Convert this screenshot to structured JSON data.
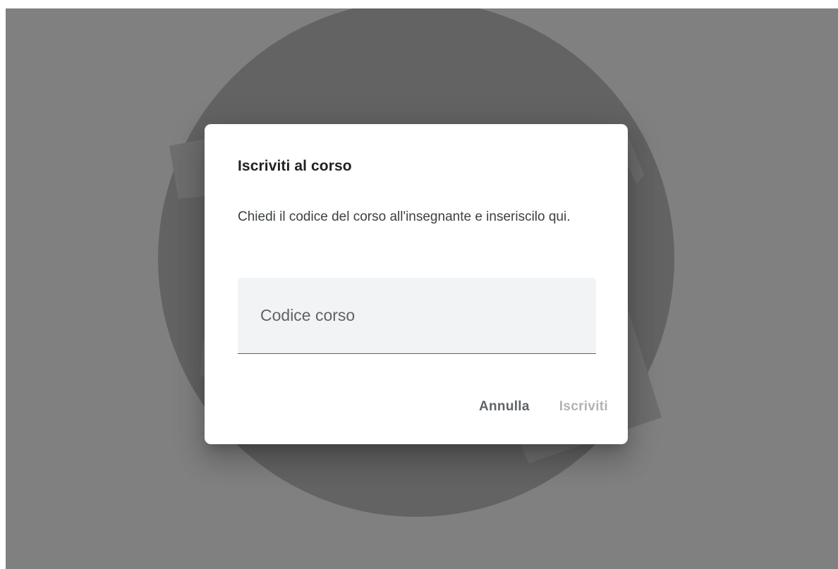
{
  "dialog": {
    "title": "Iscriviti al corso",
    "description": "Chiedi il codice del corso all'insegnante e inseriscilo qui.",
    "code_input": {
      "placeholder": "Codice corso",
      "value": ""
    },
    "cancel_label": "Annulla",
    "join_label": "Iscriviti",
    "join_enabled": false
  },
  "colors": {
    "scrim": "#808080",
    "illustration_circle": "#636363",
    "dialog_bg": "#ffffff",
    "input_bg": "#f1f3f4",
    "cancel_text": "#5f6368",
    "disabled_text": "#b0b3b6"
  }
}
